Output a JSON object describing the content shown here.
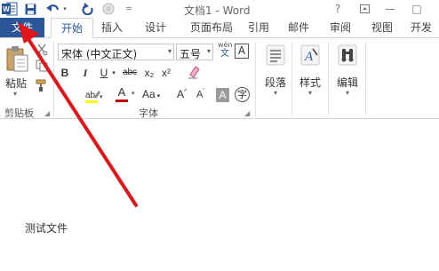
{
  "window": {
    "title": "文档1 - Word",
    "quick_access": {
      "app_icon": "word-logo-icon",
      "save_icon": "save-icon",
      "undo_icon": "undo-icon",
      "redo_icon": "redo-icon",
      "circle_icon": "circle-icon",
      "more": "="
    },
    "controls": {
      "help": "?",
      "minimize": "—",
      "maximize": "□"
    }
  },
  "tabs": [
    {
      "label": "文件"
    },
    {
      "label": "开始"
    },
    {
      "label": "插入"
    },
    {
      "label": "设计"
    },
    {
      "label": "页面布局"
    },
    {
      "label": "引用"
    },
    {
      "label": "邮件"
    },
    {
      "label": "审阅"
    },
    {
      "label": "视图"
    },
    {
      "label": "开发"
    }
  ],
  "ribbon": {
    "clipboard": {
      "paste_label": "粘贴",
      "group_label": "剪贴板"
    },
    "font": {
      "font_name": "宋体 (中文正文)",
      "font_size": "五号",
      "wen_top": "wén",
      "wen_bottom": "文",
      "char_border": "A",
      "bold": "B",
      "italic": "I",
      "underline": "U",
      "strike": "abc",
      "subscript": "x₂",
      "superscript": "x²",
      "highlight": "ab",
      "font_color": "A",
      "change_case": "Aa",
      "grow": "A",
      "shrink": "A",
      "shading": "A",
      "encircle": "字",
      "group_label": "字体",
      "font_color_value": "#c00000",
      "highlight_color": "#ffff00"
    },
    "paragraph": {
      "label": "段落"
    },
    "styles": {
      "label": "样式"
    },
    "editing": {
      "label": "编辑"
    }
  },
  "document": {
    "text": "测试文件"
  },
  "colors": {
    "accent": "#2b579a",
    "arrow": "#e0161b"
  }
}
